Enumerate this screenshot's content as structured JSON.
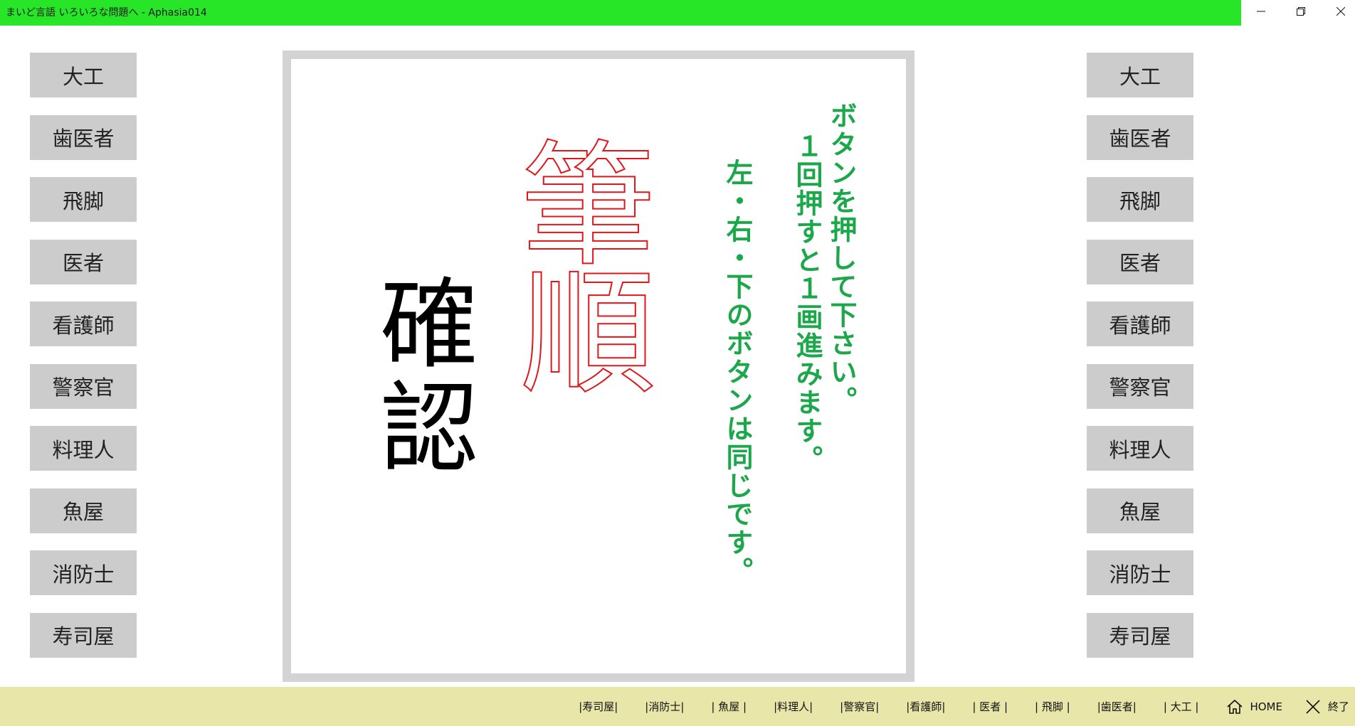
{
  "window": {
    "title": "まいど言語 いろいろな問題へ - Aphasia014",
    "minimize_glyph": "—",
    "maximize_glyph": "❐",
    "close_glyph": "✕"
  },
  "left_buttons": [
    "大工",
    "歯医者",
    "飛脚",
    "医者",
    "看護師",
    "警察官",
    "料理人",
    "魚屋",
    "消防士",
    "寿司屋"
  ],
  "right_buttons": [
    "大工",
    "歯医者",
    "飛脚",
    "医者",
    "看護師",
    "警察官",
    "料理人",
    "魚屋",
    "消防士",
    "寿司屋"
  ],
  "board": {
    "instructions": [
      "ボタンを押して下さい。",
      "１回押すと１画進みます。",
      "左・右・下のボタンは同じです。"
    ],
    "stroke_title": "筆順",
    "confirm_title": "確認"
  },
  "bottom_nav": {
    "items": [
      "|寿司屋|",
      "|消防士|",
      "| 魚屋 |",
      "|料理人|",
      "|警察官|",
      "|看護師|",
      "| 医者 |",
      "| 飛脚 |",
      "|歯医者|",
      "| 大工 |"
    ],
    "home_label": "HOME",
    "exit_label": "終了"
  },
  "colors": {
    "titlebar": "#27e627",
    "side_button": "#cccccc",
    "board_frame": "#d3d3d3",
    "instruction_text": "#1ca84a",
    "stroke_outline": "#e0161b",
    "bottom_bar": "#e8e6a8"
  }
}
